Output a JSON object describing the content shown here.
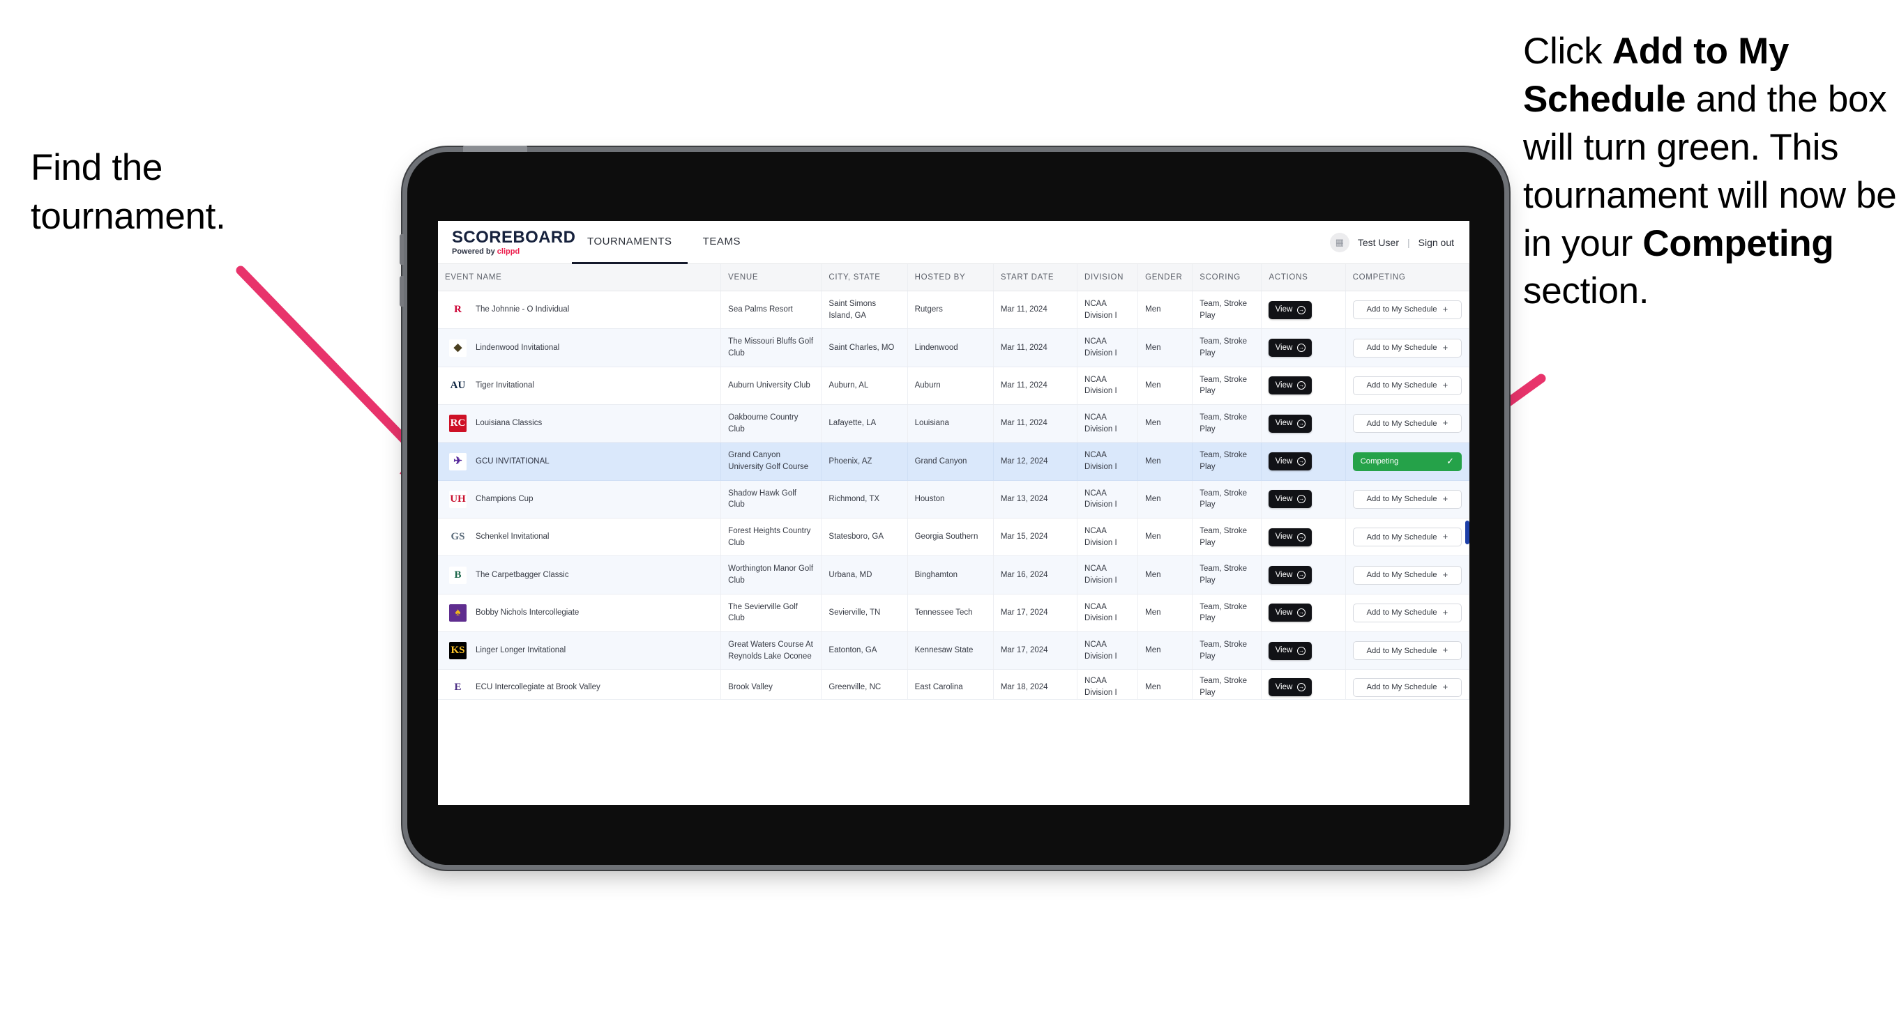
{
  "annotations": {
    "left": {
      "line1": "Find the",
      "line2": "tournament."
    },
    "right": {
      "p1_pre": "Click ",
      "p1_bold": "Add to My Schedule",
      "p1_mid": " and the box will turn green. This tournament will now be in your ",
      "p2_bold": "Competing",
      "p2_post": " section."
    },
    "arrow_color": "#e8336b"
  },
  "app": {
    "brand": {
      "title": "SCOREBOARD",
      "powered_prefix": "Powered by ",
      "powered_name": "clippd"
    },
    "nav": {
      "tabs": [
        {
          "label": "TOURNAMENTS",
          "active": true
        },
        {
          "label": "TEAMS",
          "active": false
        }
      ]
    },
    "header_right": {
      "avatar_icon": "user-avatar-icon",
      "user_name": "Test User",
      "divider": "|",
      "sign_out": "Sign out"
    },
    "table": {
      "columns": [
        "EVENT NAME",
        "VENUE",
        "CITY, STATE",
        "HOSTED BY",
        "START DATE",
        "DIVISION",
        "GENDER",
        "SCORING",
        "ACTIONS",
        "COMPETING"
      ],
      "action_label": "View",
      "add_label": "Add to My Schedule",
      "add_plus": "+",
      "competing_label": "Competing",
      "competing_check": "✓",
      "rows": [
        {
          "logo_text": "R",
          "logo_fg": "#cc0033",
          "logo_bg": "#ffffff",
          "event": "The Johnnie - O Individual",
          "venue": "Sea Palms Resort",
          "city": "Saint Simons Island, GA",
          "host": "Rutgers",
          "date": "Mar 11, 2024",
          "division": "NCAA Division I",
          "gender": "Men",
          "scoring": "Team, Stroke Play",
          "competing": false
        },
        {
          "logo_text": "◆",
          "logo_fg": "#4a3f1f",
          "logo_bg": "#ffffff",
          "event": "Lindenwood Invitational",
          "venue": "The Missouri Bluffs Golf Club",
          "city": "Saint Charles, MO",
          "host": "Lindenwood",
          "date": "Mar 11, 2024",
          "division": "NCAA Division I",
          "gender": "Men",
          "scoring": "Team, Stroke Play",
          "competing": false
        },
        {
          "logo_text": "AU",
          "logo_fg": "#0c2340",
          "logo_bg": "#ffffff",
          "event": "Tiger Invitational",
          "venue": "Auburn University Club",
          "city": "Auburn, AL",
          "host": "Auburn",
          "date": "Mar 11, 2024",
          "division": "NCAA Division I",
          "gender": "Men",
          "scoring": "Team, Stroke Play",
          "competing": false
        },
        {
          "logo_text": "RC",
          "logo_fg": "#ffffff",
          "logo_bg": "#ce1126",
          "event": "Louisiana Classics",
          "venue": "Oakbourne Country Club",
          "city": "Lafayette, LA",
          "host": "Louisiana",
          "date": "Mar 11, 2024",
          "division": "NCAA Division I",
          "gender": "Men",
          "scoring": "Team, Stroke Play",
          "competing": false
        },
        {
          "logo_text": "✈",
          "logo_fg": "#522398",
          "logo_bg": "#ffffff",
          "event": "GCU INVITATIONAL",
          "venue": "Grand Canyon University Golf Course",
          "city": "Phoenix, AZ",
          "host": "Grand Canyon",
          "date": "Mar 12, 2024",
          "division": "NCAA Division I",
          "gender": "Men",
          "scoring": "Team, Stroke Play",
          "competing": true
        },
        {
          "logo_text": "UH",
          "logo_fg": "#c8102e",
          "logo_bg": "#ffffff",
          "event": "Champions Cup",
          "venue": "Shadow Hawk Golf Club",
          "city": "Richmond, TX",
          "host": "Houston",
          "date": "Mar 13, 2024",
          "division": "NCAA Division I",
          "gender": "Men",
          "scoring": "Team, Stroke Play",
          "competing": false
        },
        {
          "logo_text": "GS",
          "logo_fg": "#5a6b7a",
          "logo_bg": "#ffffff",
          "event": "Schenkel Invitational",
          "venue": "Forest Heights Country Club",
          "city": "Statesboro, GA",
          "host": "Georgia Southern",
          "date": "Mar 15, 2024",
          "division": "NCAA Division I",
          "gender": "Men",
          "scoring": "Team, Stroke Play",
          "competing": false
        },
        {
          "logo_text": "B",
          "logo_fg": "#1a6649",
          "logo_bg": "#ffffff",
          "event": "The Carpetbagger Classic",
          "venue": "Worthington Manor Golf Club",
          "city": "Urbana, MD",
          "host": "Binghamton",
          "date": "Mar 16, 2024",
          "division": "NCAA Division I",
          "gender": "Men",
          "scoring": "Team, Stroke Play",
          "competing": false
        },
        {
          "logo_text": "♠",
          "logo_fg": "#efb81c",
          "logo_bg": "#5f2d8f",
          "event": "Bobby Nichols Intercollegiate",
          "venue": "The Sevierville Golf Club",
          "city": "Sevierville, TN",
          "host": "Tennessee Tech",
          "date": "Mar 17, 2024",
          "division": "NCAA Division I",
          "gender": "Men",
          "scoring": "Team, Stroke Play",
          "competing": false
        },
        {
          "logo_text": "KS",
          "logo_fg": "#ffc629",
          "logo_bg": "#000000",
          "event": "Linger Longer Invitational",
          "venue": "Great Waters Course At Reynolds Lake Oconee",
          "city": "Eatonton, GA",
          "host": "Kennesaw State",
          "date": "Mar 17, 2024",
          "division": "NCAA Division I",
          "gender": "Men",
          "scoring": "Team, Stroke Play",
          "competing": false
        },
        {
          "logo_text": "E",
          "logo_fg": "#4b2e83",
          "logo_bg": "#ffffff",
          "event": "ECU Intercollegiate at Brook Valley",
          "venue": "Brook Valley",
          "city": "Greenville, NC",
          "host": "East Carolina",
          "date": "Mar 18, 2024",
          "division": "NCAA Division I",
          "gender": "Men",
          "scoring": "Team, Stroke Play",
          "competing": false,
          "clipped": true
        }
      ]
    }
  }
}
